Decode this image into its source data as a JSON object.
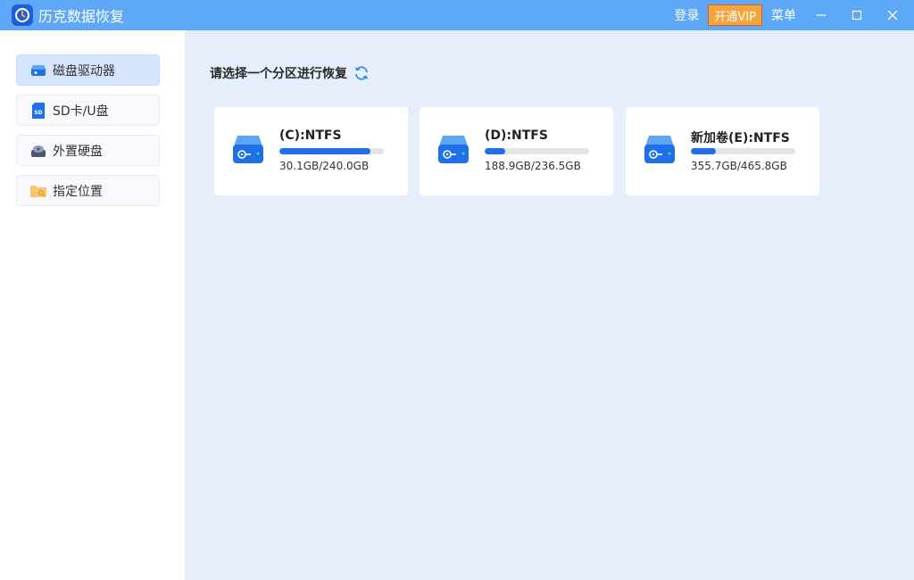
{
  "app": {
    "title": "历克数据恢复"
  },
  "titlebar": {
    "login": "登录",
    "vip": "开通VIP",
    "menu": "菜单",
    "minimize": "—",
    "maximize": "☐",
    "close": "✕"
  },
  "sidebar": {
    "items": [
      {
        "label": "磁盘驱动器",
        "icon": "hdd-icon",
        "active": true
      },
      {
        "label": "SD卡/U盘",
        "icon": "sd-card-icon",
        "active": false
      },
      {
        "label": "外置硬盘",
        "icon": "external-drive-icon",
        "active": false
      },
      {
        "label": "指定位置",
        "icon": "folder-icon",
        "active": false
      }
    ]
  },
  "main": {
    "title": "请选择一个分区进行恢复",
    "drives": [
      {
        "name": "(C):NTFS",
        "size": "30.1GB/240.0GB",
        "used_fraction": 0.875
      },
      {
        "name": "(D):NTFS",
        "size": "188.9GB/236.5GB",
        "used_fraction": 0.2
      },
      {
        "name": "新加卷(E):NTFS",
        "size": "355.7GB/465.8GB",
        "used_fraction": 0.24
      }
    ]
  },
  "colors": {
    "accent": "#1e6fe8",
    "titlebar": "#5da9f7",
    "vip": "#f6a53c"
  }
}
